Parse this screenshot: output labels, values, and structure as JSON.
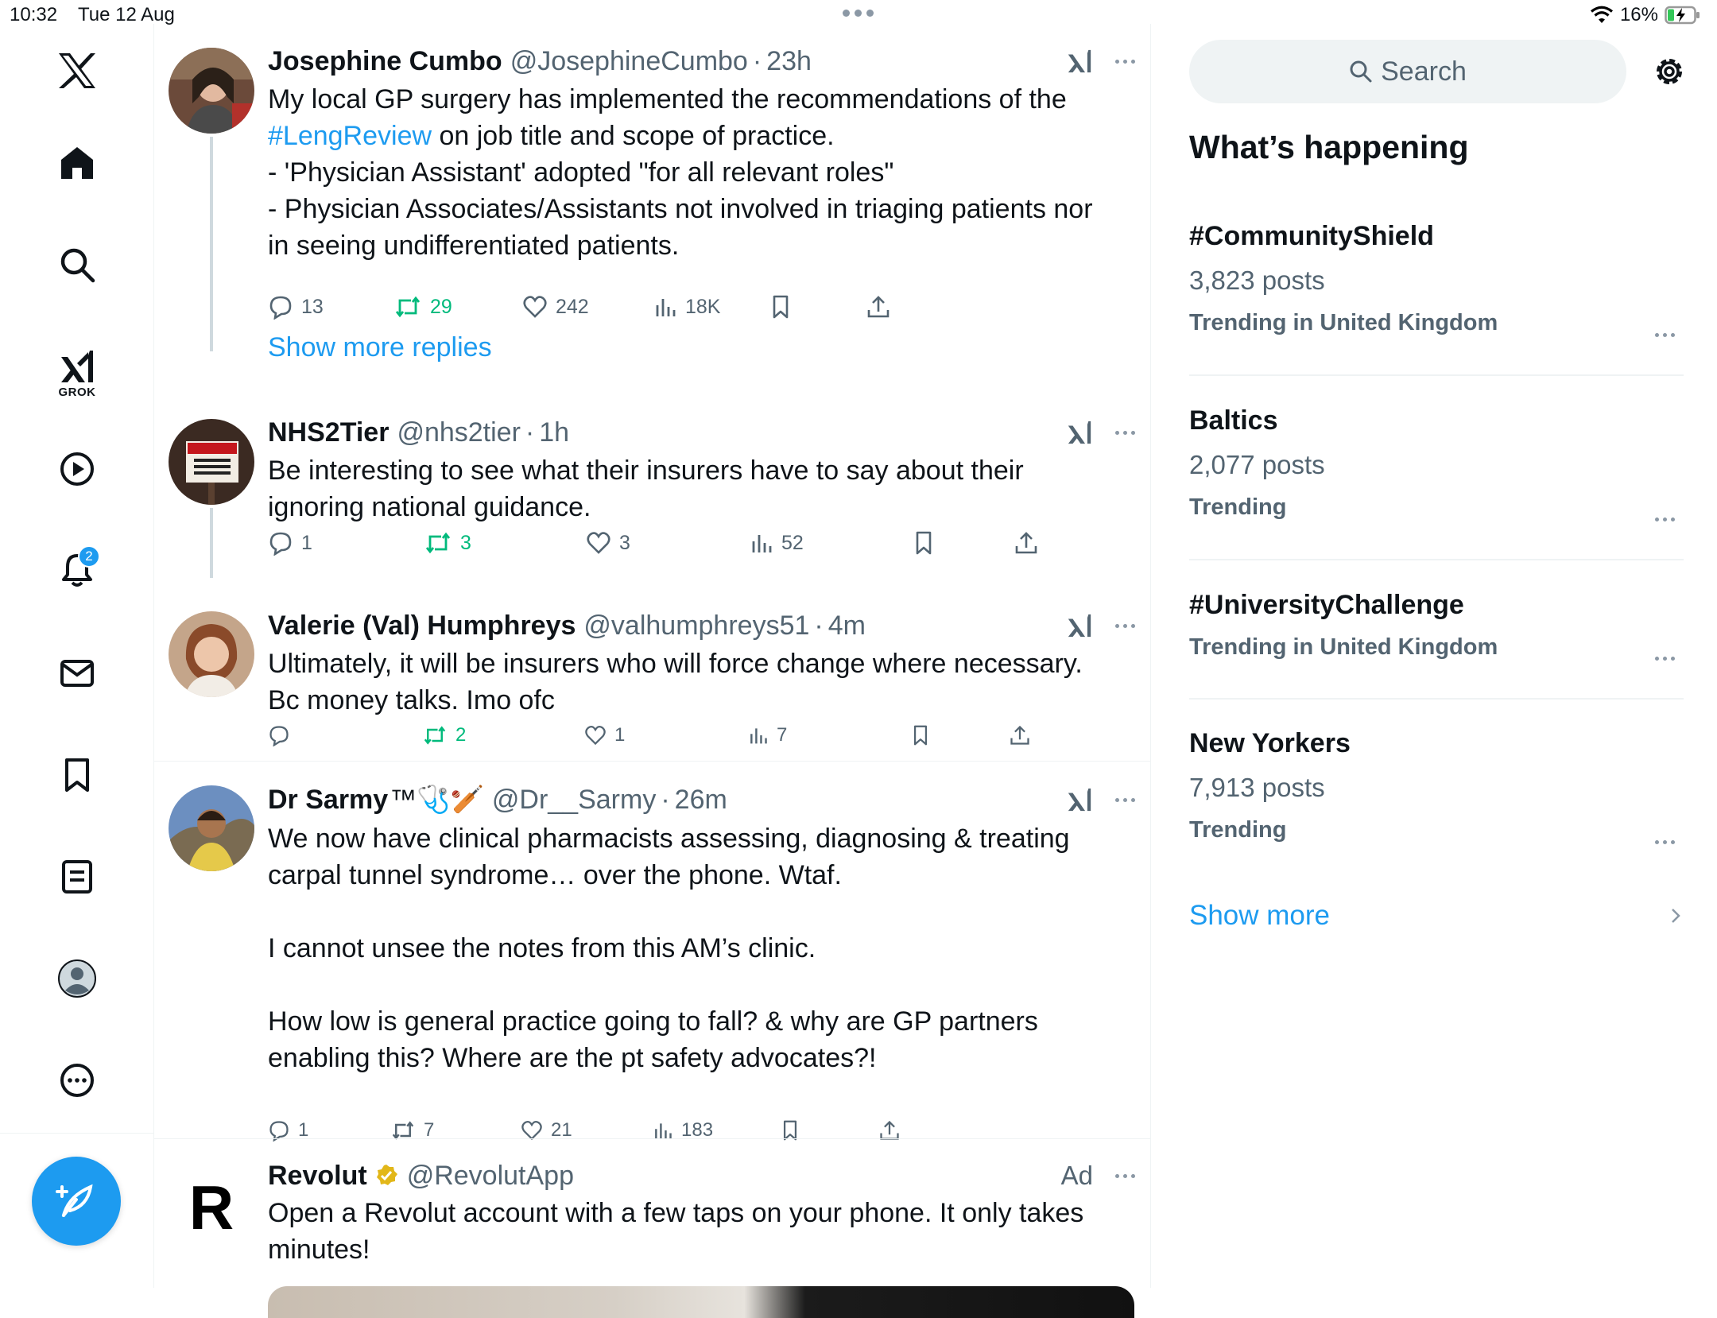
{
  "status_bar": {
    "time": "10:32",
    "date": "Tue 12 Aug",
    "battery": "16%"
  },
  "nav": {
    "grok_label": "GROK",
    "notifications_badge": "2",
    "items": [
      "x-logo",
      "home",
      "explore",
      "grok",
      "video",
      "notifications",
      "messages",
      "bookmarks",
      "lists",
      "profile",
      "more"
    ]
  },
  "posts": [
    {
      "name": "Josephine Cumbo",
      "handle": "@JosephineCumbo",
      "time": "23h",
      "text_line1": "My local GP surgery has implemented the recommendations of the",
      "hashtag": "#LengReview",
      "text_line2_rest": " on job title and scope of practice.",
      "text_rest": "- 'Physician Assistant' adopted \"for all relevant roles\"\n- Physician Associates/Assistants not involved in triaging patients nor\nin seeing undifferentiated patients.",
      "replies": "13",
      "reposts": "29",
      "likes": "242",
      "views": "18K"
    },
    {
      "name": "NHS2Tier",
      "handle": "@nhs2tier",
      "time": "1h",
      "text": "Be interesting to see what their insurers have to say about their\nignoring national guidance.",
      "replies": "1",
      "reposts": "3",
      "likes": "3",
      "views": "52"
    },
    {
      "name": "Valerie (Val) Humphreys",
      "handle": "@valhumphreys51",
      "time": "4m",
      "text": "Ultimately, it will be insurers who will force change where necessary.\nBc money talks. Imo ofc",
      "replies": "",
      "reposts": "2",
      "likes": "1",
      "views": "7"
    },
    {
      "name": "Dr Sarmy",
      "name_suffix": "™🩺🏏",
      "handle": "@Dr__Sarmy",
      "time": "26m",
      "text": "We now have clinical pharmacists assessing, diagnosing & treating\ncarpal tunnel syndrome… over the phone. Wtaf.\n\nI cannot unsee the notes from this AM’s clinic.\n\nHow low is general practice going to fall? & why are GP partners\nenabling this? Where are the pt safety advocates?!",
      "replies": "1",
      "reposts": "7",
      "likes": "21",
      "views": "183"
    },
    {
      "name": "Revolut",
      "handle": "@RevolutApp",
      "ad_label": "Ad",
      "logo_letter": "R",
      "text": "Open a Revolut account with a few taps on your phone. It only takes\nminutes!"
    }
  ],
  "show_more_replies": "Show more replies",
  "sidebar": {
    "search_placeholder": "Search",
    "title": "What’s happening",
    "trends": [
      {
        "name": "#CommunityShield",
        "count": "3,823 posts",
        "context": "Trending in United Kingdom"
      },
      {
        "name": "Baltics",
        "count": "2,077 posts",
        "context": "Trending"
      },
      {
        "name": "#UniversityChallenge",
        "count": "",
        "context": "Trending in United Kingdom"
      },
      {
        "name": "New Yorkers",
        "count": "7,913 posts",
        "context": "Trending"
      }
    ],
    "show_more": "Show more"
  },
  "colors": {
    "accent": "#1d9bf0",
    "repost_green": "#00ba7c",
    "muted": "#536471",
    "text": "#0f1419"
  }
}
